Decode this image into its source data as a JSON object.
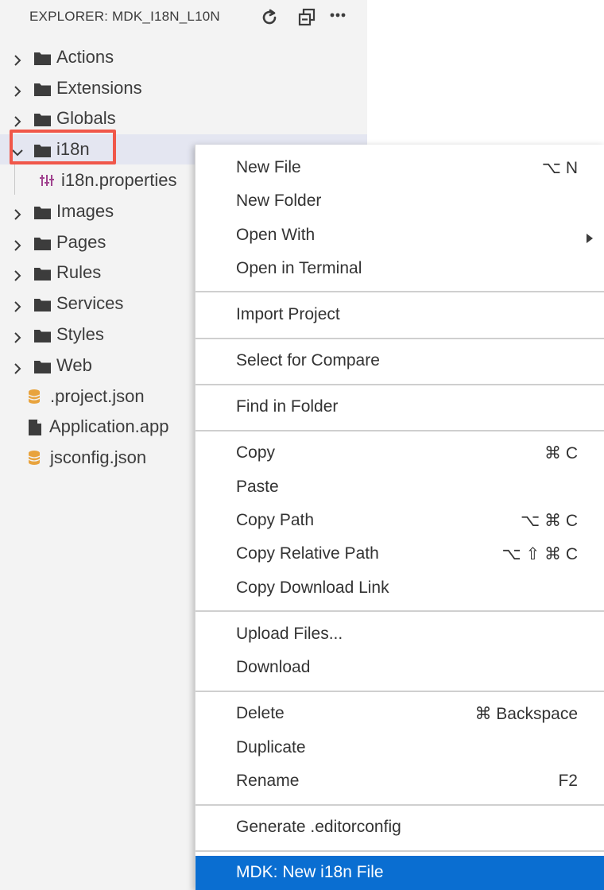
{
  "explorer": {
    "title": "EXPLORER: MDK_I18N_L10N",
    "header_icons": [
      "refresh-icon",
      "collapse-all-icon",
      "more-actions-icon"
    ],
    "tree": [
      {
        "label": "Actions",
        "type": "folder",
        "expanded": false
      },
      {
        "label": "Extensions",
        "type": "folder",
        "expanded": false
      },
      {
        "label": "Globals",
        "type": "folder",
        "expanded": false
      },
      {
        "label": "i18n",
        "type": "folder",
        "expanded": true,
        "selected": true
      },
      {
        "label": "i18n.properties",
        "type": "properties-file"
      },
      {
        "label": "Images",
        "type": "folder",
        "expanded": false
      },
      {
        "label": "Pages",
        "type": "folder",
        "expanded": false
      },
      {
        "label": "Rules",
        "type": "folder",
        "expanded": false
      },
      {
        "label": "Services",
        "type": "folder",
        "expanded": false
      },
      {
        "label": "Styles",
        "type": "folder",
        "expanded": false
      },
      {
        "label": "Web",
        "type": "folder",
        "expanded": false
      },
      {
        "label": ".project.json",
        "type": "json-file"
      },
      {
        "label": "Application.app",
        "type": "file"
      },
      {
        "label": "jsconfig.json",
        "type": "json-file"
      }
    ]
  },
  "context_menu": {
    "groups": [
      [
        {
          "label": "New File",
          "shortcut": "⌥ N"
        },
        {
          "label": "New Folder",
          "shortcut": ""
        },
        {
          "label": "Open With",
          "shortcut": "",
          "submenu": true
        },
        {
          "label": "Open in Terminal",
          "shortcut": ""
        }
      ],
      [
        {
          "label": "Import Project",
          "shortcut": ""
        }
      ],
      [
        {
          "label": "Select for Compare",
          "shortcut": ""
        }
      ],
      [
        {
          "label": "Find in Folder",
          "shortcut": ""
        }
      ],
      [
        {
          "label": "Copy",
          "shortcut": "⌘ C"
        },
        {
          "label": "Paste",
          "shortcut": ""
        },
        {
          "label": "Copy Path",
          "shortcut": "⌥ ⌘ C"
        },
        {
          "label": "Copy Relative Path",
          "shortcut": "⌥ ⇧ ⌘ C"
        },
        {
          "label": "Copy Download Link",
          "shortcut": ""
        }
      ],
      [
        {
          "label": "Upload Files...",
          "shortcut": ""
        },
        {
          "label": "Download",
          "shortcut": ""
        }
      ],
      [
        {
          "label": "Delete",
          "shortcut": "⌘ Backspace"
        },
        {
          "label": "Duplicate",
          "shortcut": ""
        },
        {
          "label": "Rename",
          "shortcut": "F2"
        }
      ],
      [
        {
          "label": "Generate .editorconfig",
          "shortcut": ""
        }
      ],
      [
        {
          "label": "MDK: New i18n File",
          "shortcut": "",
          "active": true
        }
      ]
    ]
  },
  "colors": {
    "sidebar_bg": "#f3f3f3",
    "selected_row": "#e4e6f1",
    "highlight_border": "#f0574a",
    "menu_active": "#0a6ed1",
    "json_icon": "#e8a33d",
    "properties_icon": "#a0438f"
  }
}
